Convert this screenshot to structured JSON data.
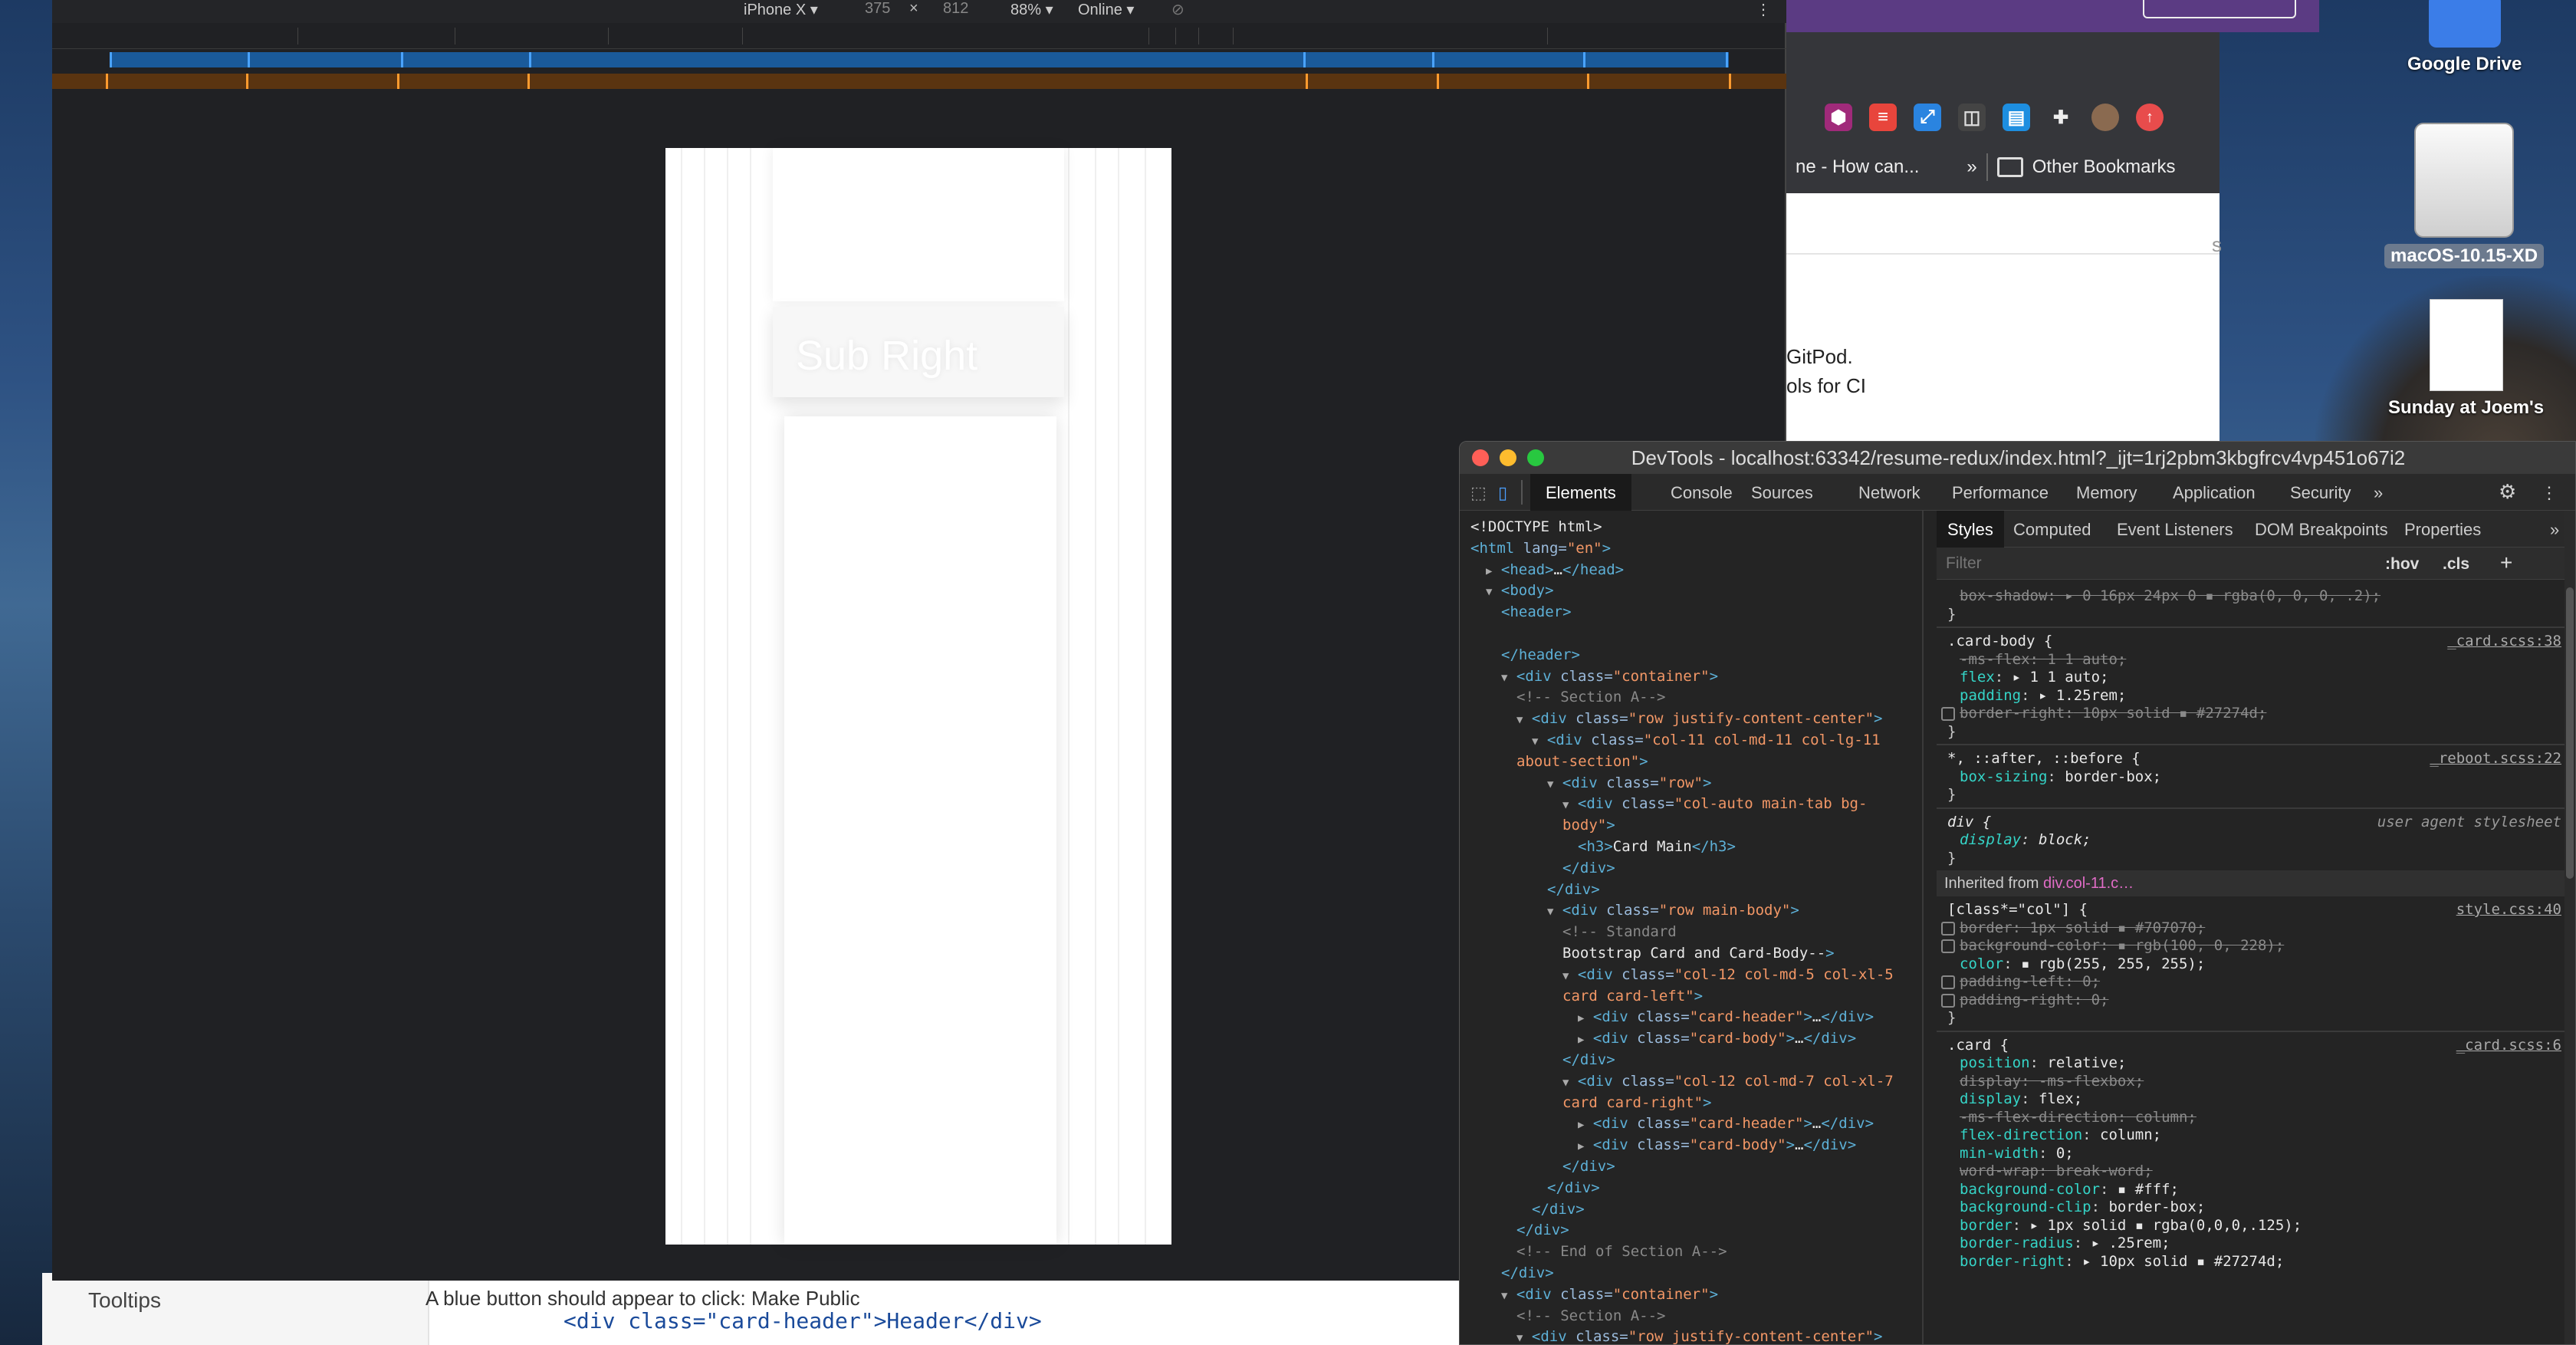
{
  "device_toolbar": {
    "device": "iPhone X ▾",
    "width": "375",
    "times": "×",
    "height": "812",
    "zoom": "88% ▾",
    "network": "Online ▾",
    "more": "⋮"
  },
  "page_preview": {
    "card_title": "Sub Right"
  },
  "browser": {
    "bookmark_truncated": "ne - How can...",
    "overflow": "»",
    "other_bookmarks": "Other Bookmarks",
    "text_s": "s",
    "text_gitpod": "GitPod.",
    "text_ci": "ols for CI"
  },
  "desktop": {
    "google_drive": "Google Drive",
    "disk_label": "macOS-10.15-XD",
    "screenshot_label": "Sunday at Joem's"
  },
  "behind_page": {
    "tooltips": "Tooltips",
    "blue_button_text": "A blue button should appear to click: Make Public",
    "code_line": "<div class=\"card-header\">Header</div>"
  },
  "devtools": {
    "title": "DevTools - localhost:63342/resume-redux/index.html?_ijt=1rj2pbm3kbgfrcv4vp451o67i2",
    "tabs": [
      "Elements",
      "Console",
      "Sources",
      "Network",
      "Performance",
      "Memory",
      "Application",
      "Security",
      "»"
    ],
    "styles_tabs": [
      "Styles",
      "Computed",
      "Event Listeners",
      "DOM Breakpoints",
      "Properties",
      "»"
    ],
    "filter_placeholder": "Filter",
    "hov": ":hov",
    "cls": ".cls",
    "plus": "+",
    "inherited_label": "Inherited from ",
    "inherited_from": "div.col-11.c…",
    "colors": {
      "border_color": "#27274d",
      "bg_purple": "#6400e4"
    }
  },
  "dom_lines": [
    {
      "indent": 0,
      "arrow": "",
      "html": "<!DOCTYPE html>"
    },
    {
      "indent": 0,
      "arrow": "",
      "html": "<html lang=\"en\">"
    },
    {
      "indent": 1,
      "arrow": "▶",
      "html": "<head>…</head>"
    },
    {
      "indent": 1,
      "arrow": "▼",
      "html": "<body>"
    },
    {
      "indent": 2,
      "arrow": "",
      "html": "<header>"
    },
    {
      "indent": 2,
      "arrow": "",
      "html": ""
    },
    {
      "indent": 2,
      "arrow": "",
      "html": "</header>"
    },
    {
      "indent": 2,
      "arrow": "▼",
      "html": "<div class=\"container\">"
    },
    {
      "indent": 3,
      "arrow": "",
      "html": "<!--    Section A-->"
    },
    {
      "indent": 3,
      "arrow": "▼",
      "html": "<div class=\"row justify-content-center\">"
    },
    {
      "indent": 4,
      "arrow": "▼",
      "html": "<div class=\"col-11 col-md-11 col-lg-11"
    },
    {
      "indent": 3,
      "arrow": "",
      "html": "about-section\">"
    },
    {
      "indent": 5,
      "arrow": "▼",
      "html": "<div class=\"row\">"
    },
    {
      "indent": 6,
      "arrow": "▼",
      "html": "<div class=\"col-auto main-tab bg-"
    },
    {
      "indent": 6,
      "arrow": "",
      "html": "body\">"
    },
    {
      "indent": 7,
      "arrow": "",
      "html": "<h3>Card Main</h3>"
    },
    {
      "indent": 6,
      "arrow": "",
      "html": "</div>"
    },
    {
      "indent": 5,
      "arrow": "",
      "html": "</div>"
    },
    {
      "indent": 5,
      "arrow": "▼",
      "html": "<div class=\"row main-body\">"
    },
    {
      "indent": 6,
      "arrow": "",
      "html": "<!--              Standard"
    },
    {
      "indent": 6,
      "arrow": "",
      "html": "Bootstrap Card and Card-Body-->"
    },
    {
      "indent": 6,
      "arrow": "▼",
      "html": "<div class=\"col-12 col-md-5 col-xl-5"
    },
    {
      "indent": 6,
      "arrow": "",
      "html": "card card-left\">"
    },
    {
      "indent": 7,
      "arrow": "▶",
      "html": "<div class=\"card-header\">…</div>"
    },
    {
      "indent": 7,
      "arrow": "▶",
      "html": "<div class=\"card-body\">…</div>"
    },
    {
      "indent": 6,
      "arrow": "",
      "html": "</div>"
    },
    {
      "indent": 6,
      "arrow": "▼",
      "html": "<div class=\"col-12 col-md-7 col-xl-7"
    },
    {
      "indent": 6,
      "arrow": "",
      "html": "card card-right\">"
    },
    {
      "indent": 7,
      "arrow": "▶",
      "html": "<div class=\"card-header\">…</div>"
    },
    {
      "indent": 7,
      "arrow": "▶",
      "html": "<div class=\"card-body\">…</div>"
    },
    {
      "indent": 6,
      "arrow": "",
      "html": "</div>"
    },
    {
      "indent": 5,
      "arrow": "",
      "html": "</div>"
    },
    {
      "indent": 4,
      "arrow": "",
      "html": "</div>"
    },
    {
      "indent": 3,
      "arrow": "",
      "html": "</div>"
    },
    {
      "indent": 3,
      "arrow": "",
      "html": "<!--    End of Section A-->"
    },
    {
      "indent": 2,
      "arrow": "",
      "html": "</div>"
    },
    {
      "indent": 2,
      "arrow": "▼",
      "html": "<div class=\"container\">"
    },
    {
      "indent": 3,
      "arrow": "",
      "html": "<!--    Section A-->"
    },
    {
      "indent": 3,
      "arrow": "▼",
      "html": "<div class=\"row justify-content-center\">"
    },
    {
      "indent": 4,
      "arrow": "",
      "html": "<div class=\"col-11 col-md-11 col-lg-11"
    }
  ],
  "styles": {
    "box_shadow_line": "box-shadow: ▸ 0 16px 24px 0 ▪ rgba(0, 0, 0, .2);",
    "close": "}",
    "card_body": {
      "selector": ".card-body {",
      "source": "_card.scss:38",
      "props": [
        {
          "t": "-ms-flex: 1 1 auto;",
          "strike": true
        },
        {
          "t": "flex: ▸ 1 1 auto;",
          "strike": false
        },
        {
          "t": "padding: ▸ 1.25rem;",
          "strike": false
        },
        {
          "t": "border-right: 10px solid ▪ #27274d;",
          "strike": true
        }
      ]
    },
    "universal": {
      "selector": "*, ::after, ::before {",
      "source": "_reboot.scss:22",
      "prop": "box-sizing: border-box;"
    },
    "div_rule": {
      "selector": "div {",
      "source": "user agent stylesheet",
      "prop": "display: block;"
    },
    "col_rule": {
      "selector": "[class*=\"col\"] {",
      "source": "style.css:40",
      "props": [
        {
          "t": "border: 1px solid ▪ #707070;",
          "strike": true
        },
        {
          "t": "background-color: ▪ rgb(100, 0, 228);",
          "strike": true
        },
        {
          "t": "color: ▪ rgb(255, 255, 255);",
          "strike": false
        },
        {
          "t": "padding-left: 0;",
          "strike": true
        },
        {
          "t": "padding-right: 0;",
          "strike": true
        }
      ]
    },
    "card_rule": {
      "selector": ".card {",
      "source": "_card.scss:6",
      "props": [
        {
          "t": "position: relative;",
          "strike": false
        },
        {
          "t": "display: -ms-flexbox;",
          "strike": true
        },
        {
          "t": "display: flex;",
          "strike": false
        },
        {
          "t": "-ms-flex-direction: column;",
          "strike": true
        },
        {
          "t": "flex-direction: column;",
          "strike": false
        },
        {
          "t": "min-width: 0;",
          "strike": false
        },
        {
          "t": "word-wrap: break-word;",
          "strike": true
        },
        {
          "t": "background-color: ▪ #fff;",
          "strike": false
        },
        {
          "t": "background-clip: border-box;",
          "strike": false
        },
        {
          "t": "border: ▸ 1px solid ▪ rgba(0,0,0,.125);",
          "strike": false
        },
        {
          "t": "border-radius: ▸ .25rem;",
          "strike": false
        },
        {
          "t": "border-right: ▸ 10px solid ▪ #27274d;",
          "strike": false
        }
      ]
    }
  }
}
